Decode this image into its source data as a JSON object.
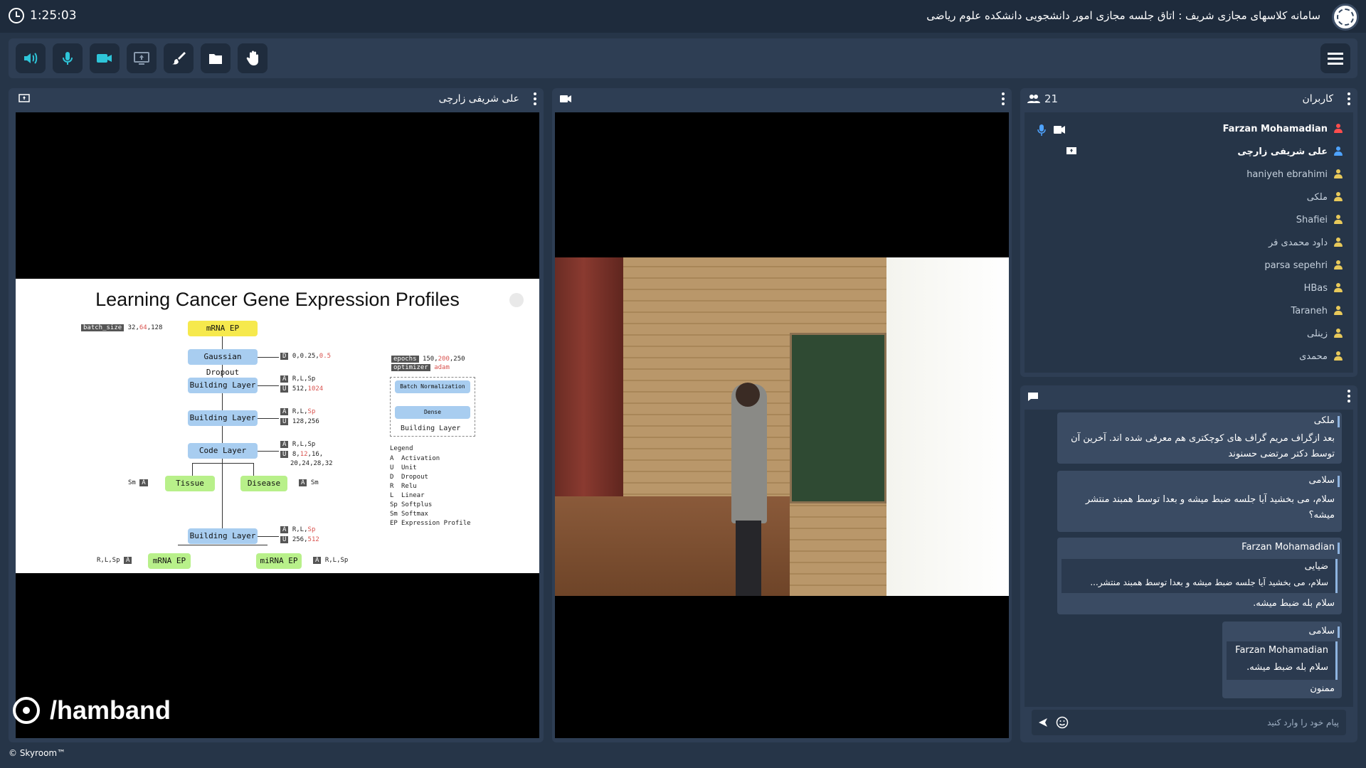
{
  "header": {
    "timer": "1:25:03",
    "title": "سامانه کلاسهای مجازی شریف : اتاق جلسه مجازی امور دانشجویی دانشکده علوم ریاضی"
  },
  "toolbar": {
    "buttons": [
      "speaker-icon",
      "microphone-icon",
      "camera-icon",
      "screen-share-icon",
      "brush-icon",
      "folder-icon",
      "raise-hand-icon"
    ],
    "accent": "#2ec5d9"
  },
  "panels": {
    "presenter": {
      "title": "علی شریفی زارچی"
    },
    "users": {
      "count": "21",
      "title": "کاربران",
      "list": [
        {
          "name": "Farzan Mohamadian",
          "role": "admin"
        },
        {
          "name": "علی شریفی زارچی",
          "role": "presenter"
        },
        {
          "name": "haniyeh ebrahimi",
          "role": "user"
        },
        {
          "name": "ملکی",
          "role": "user"
        },
        {
          "name": "Shafiei",
          "role": "user"
        },
        {
          "name": "داود محمدی فر",
          "role": "user"
        },
        {
          "name": "parsa sepehri",
          "role": "user"
        },
        {
          "name": "HBas",
          "role": "user"
        },
        {
          "name": "Taraneh",
          "role": "user"
        },
        {
          "name": "زینلی",
          "role": "user"
        },
        {
          "name": "محمدی",
          "role": "user"
        }
      ]
    },
    "chat": {
      "messages": [
        {
          "author": "ملکی",
          "text": "بعد ازگراف مریم گراف های کوچکتری هم معرفی شده اند. آخرین آن توسط دکتر مرتضی حسنوند"
        },
        {
          "author": "سلامی",
          "text": "سلام، می بخشید آیا جلسه ضبط میشه و بعدا توسط همبند منتشر میشه؟"
        },
        {
          "author": "Farzan Mohamadian",
          "reply_author": "ضیایی",
          "reply_text": "سلام، می بخشید آیا جلسه ضبط میشه و بعدا توسط همبند منتشر...",
          "text": "سلام بله ضبط میشه."
        },
        {
          "author": "سلامی",
          "reply_author": "Farzan Mohamadian",
          "reply_text": "سلام بله ضبط میشه.",
          "text": "ممنون"
        }
      ],
      "input_placeholder": "پیام خود را وارد کنید"
    }
  },
  "slide": {
    "title": "Learning Cancer Gene Expression Profiles",
    "batch_label": "batch_size",
    "batch_values": "32,",
    "batch_red": "64",
    "batch_tail": ",128",
    "mrna_ep": "mRNA EP",
    "gaussian": "Gaussian Dropout",
    "dropout_vals": "0,0.25,",
    "dropout_red": "0.5",
    "building_layer": "Building Layer",
    "code_layer": "Code Layer",
    "tissue": "Tissue",
    "disease": "Disease",
    "mirna_ep": "miRNA EP",
    "act1": "R,L,Sp",
    "units1": "512,",
    "units1_red": "1024",
    "act2": "R,L,",
    "act2_red": "Sp",
    "units2": "128,256",
    "act3": "R,L,Sp",
    "units3a": "8,",
    "units3a_red": "12",
    "units3b": ",16,",
    "units3c": "20,24,28,32",
    "act4": "R,L,",
    "act4_red": "Sp",
    "units4": "256,",
    "units4_red": "512",
    "sm": "Sm",
    "out_act": "R,L,Sp",
    "epochs_label": "epochs",
    "epochs_vals": "150,",
    "epochs_red": "200",
    "epochs_tail": ",250",
    "optimizer_label": "optimizer",
    "optimizer_val": "adam",
    "batch_norm": "Batch Normalization",
    "dense": "Dense",
    "bl_legend": "Building Layer",
    "legend_title": "Legend",
    "legend": [
      {
        "k": "A",
        "v": "Activation"
      },
      {
        "k": "U",
        "v": "Unit"
      },
      {
        "k": "D",
        "v": "Dropout"
      },
      {
        "k": "R",
        "v": "Relu"
      },
      {
        "k": "L",
        "v": "Linear"
      },
      {
        "k": "Sp",
        "v": "Softplus"
      },
      {
        "k": "Sm",
        "v": "Softmax"
      },
      {
        "k": "EP",
        "v": "Expression Profile"
      }
    ]
  },
  "watermark": "/hamband",
  "footer": "© Skyroom™"
}
